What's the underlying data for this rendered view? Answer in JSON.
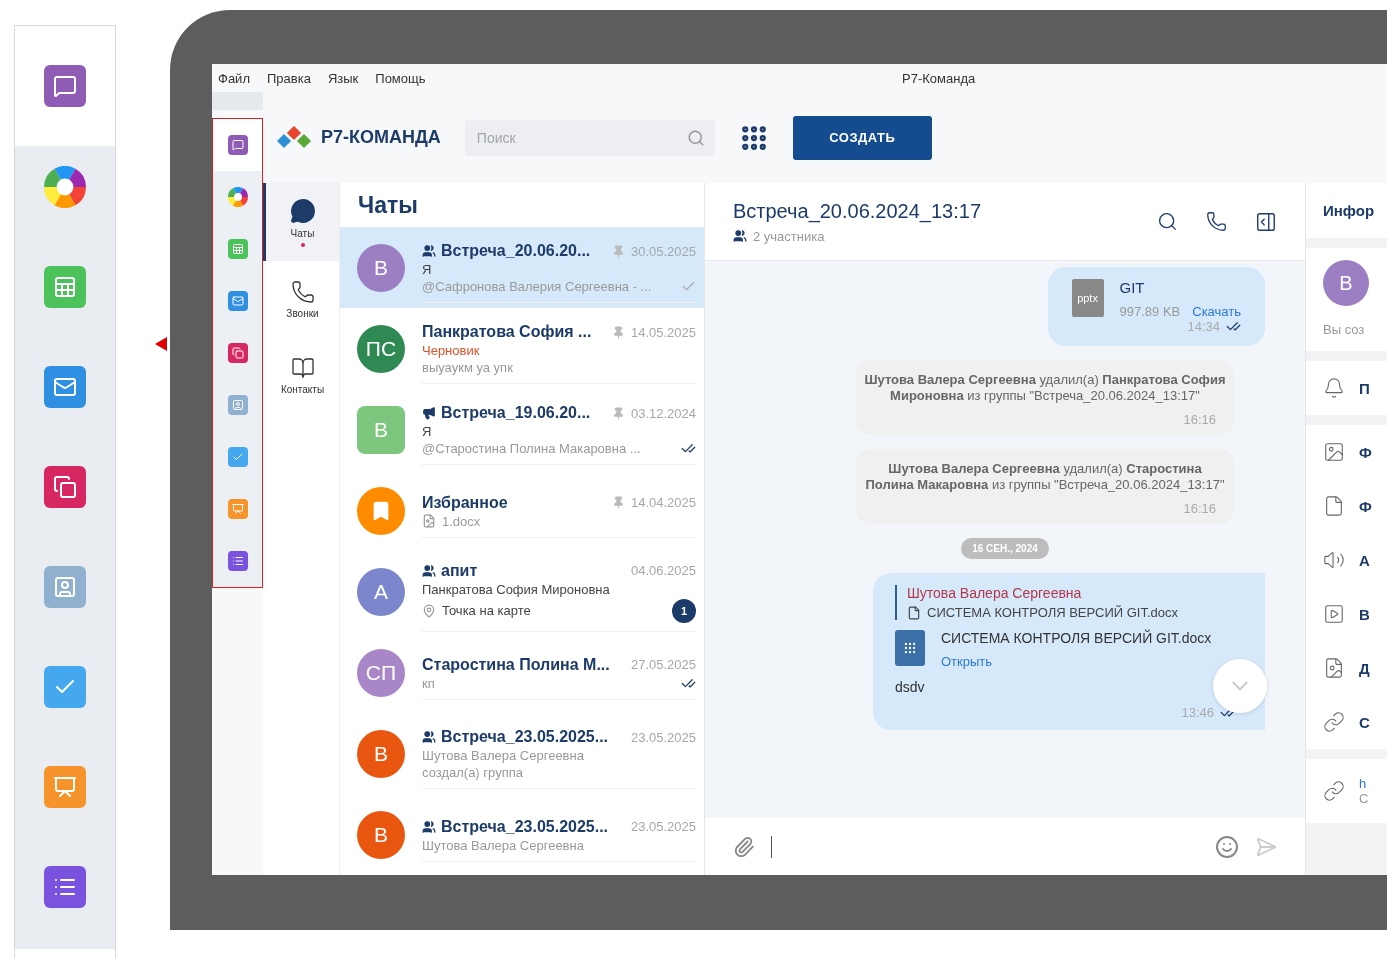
{
  "window": {
    "title": "Р7-Команда",
    "menu": [
      "Файл",
      "Правка",
      "Язык",
      "Помощь"
    ]
  },
  "apps": [
    {
      "kind": "chat",
      "color": "#8e5bb5",
      "selected": true
    },
    {
      "kind": "wheel",
      "selected": false
    },
    {
      "kind": "sheet",
      "color": "#4cc25a",
      "selected": false
    },
    {
      "kind": "mail",
      "color": "#2f8fe0",
      "selected": false
    },
    {
      "kind": "shapes",
      "color": "#d62763",
      "selected": false
    },
    {
      "kind": "contacts",
      "color": "#8fb1cf",
      "selected": false
    },
    {
      "kind": "tasks",
      "color": "#45a8ef",
      "selected": false
    },
    {
      "kind": "slides",
      "color": "#f6932b",
      "selected": false
    },
    {
      "kind": "list",
      "color": "#7a52e0",
      "selected": false
    }
  ],
  "header": {
    "brand": "Р7-КОМАНДА",
    "search": {
      "placeholder": "Поиск"
    },
    "create_button": "СОЗДАТЬ"
  },
  "nav": [
    {
      "kind": "chats",
      "label": "Чаты",
      "selected": true,
      "unread": true
    },
    {
      "kind": "calls",
      "label": "Звонки",
      "selected": false,
      "unread": false
    },
    {
      "kind": "contacts",
      "label": "Контакты",
      "selected": false,
      "unread": false
    }
  ],
  "chats": {
    "title": "Чаты",
    "items": [
      {
        "avatar": "В",
        "color": "#9b7fc2",
        "group": true,
        "name": "Встреча_20.06.20...",
        "pinned": true,
        "date": "30.05.2025",
        "lines": [
          {
            "text": "Я",
            "kind": "author"
          },
          {
            "text": "@Сафронова Валерия Сергеевна - ...",
            "kind": "muted"
          }
        ],
        "delivered": true,
        "read": false,
        "selected": true
      },
      {
        "avatar": "ПС",
        "color": "#2e8a52",
        "name": "Панкратова София ...",
        "pinned": true,
        "date": "14.05.2025",
        "lines": [
          {
            "text": "Черновик",
            "kind": "draft"
          },
          {
            "text": "выуаукм уа упк",
            "kind": "muted"
          }
        ],
        "selected": false
      },
      {
        "avatar": "В",
        "square": true,
        "color": "#7dc67e",
        "channel": true,
        "name": "Встреча_19.06.20...",
        "pinned": true,
        "date": "03.12.2024",
        "lines": [
          {
            "text": "Я",
            "kind": "author"
          },
          {
            "text": "@Старостина Полина Макаровна ...",
            "kind": "muted"
          }
        ],
        "delivered": true,
        "read": true,
        "selected": false
      },
      {
        "bookmark": true,
        "color": "#ff8c00",
        "name": "Избранное",
        "pinned": true,
        "date": "14.04.2025",
        "lines": [
          {
            "text": "1.docx",
            "kind": "file"
          }
        ],
        "selected": false
      },
      {
        "avatar": "А",
        "color": "#7b86cc",
        "group": true,
        "name": "апит",
        "date": "04.06.2025",
        "lines": [
          {
            "text": "Панкратова София Мироновна",
            "kind": "author"
          },
          {
            "text": "Точка на карте",
            "kind": "location"
          }
        ],
        "unread": "1",
        "selected": false
      },
      {
        "avatar": "СП",
        "color": "#a986c8",
        "name": "Старостина Полина М...",
        "date": "27.05.2025",
        "lines": [
          {
            "text": "кп",
            "kind": "muted"
          }
        ],
        "delivered": true,
        "read": true,
        "selected": false
      },
      {
        "avatar": "В",
        "color": "#e8560f",
        "group": true,
        "name": "Встреча_23.05.2025...",
        "date": "23.05.2025",
        "lines": [
          {
            "text": "Шутова Валера Сергеевна",
            "kind": "muted"
          },
          {
            "text": "создал(а) группа",
            "kind": "muted"
          }
        ],
        "selected": false
      },
      {
        "avatar": "В",
        "color": "#e8560f",
        "group": true,
        "name": "Встреча_23.05.2025...",
        "date": "23.05.2025",
        "lines": [
          {
            "text": "Шутова Валера Сергеевна",
            "kind": "muted"
          }
        ],
        "selected": false
      }
    ]
  },
  "conversation": {
    "title": "Встреча_20.06.2024_13:17",
    "participants": "2 участника",
    "messages": [
      {
        "kind": "file",
        "badge": "pptx",
        "name": "GIT",
        "size": "997.89 KB",
        "action": "Скачать",
        "time": "14:34",
        "read": true
      },
      {
        "kind": "system",
        "text": "**Шутова Валера Сергеевна** удалил(а) **Панкратова София Мироновна** из группы \"Встреча_20.06.2024_13:17\"",
        "time": "16:16"
      },
      {
        "kind": "system",
        "text": "**Шутова Валера Сергеевна** удалил(а) **Старостина Полина Макаровна** из группы \"Встреча_20.06.2024_13:17\"",
        "time": "16:16"
      },
      {
        "kind": "date",
        "text": "16 СЕН., 2024"
      },
      {
        "kind": "reply",
        "quote_author": "Шутова Валера Сергеевна",
        "quote_file": "СИСТЕМА КОНТРОЛЯ ВЕРСИЙ GIT.docx",
        "name": "СИСТЕМА КОНТРОЛЯ ВЕРСИЙ GIT.docx",
        "action": "Открыть",
        "text": "dsdv",
        "time": "13:46",
        "read": true
      }
    ]
  },
  "info": {
    "title": "Инфор",
    "avatar": "В",
    "note": "Вы соз",
    "items": [
      {
        "kind": "bell",
        "label": "П"
      },
      {
        "kind": "image",
        "label": "Ф"
      },
      {
        "kind": "file",
        "label": "Ф"
      },
      {
        "kind": "audio",
        "label": "А"
      },
      {
        "kind": "video",
        "label": "В"
      },
      {
        "kind": "doc",
        "label": "Д"
      },
      {
        "kind": "link",
        "label": "С"
      }
    ],
    "link": {
      "url": "h",
      "sub": "С"
    }
  }
}
